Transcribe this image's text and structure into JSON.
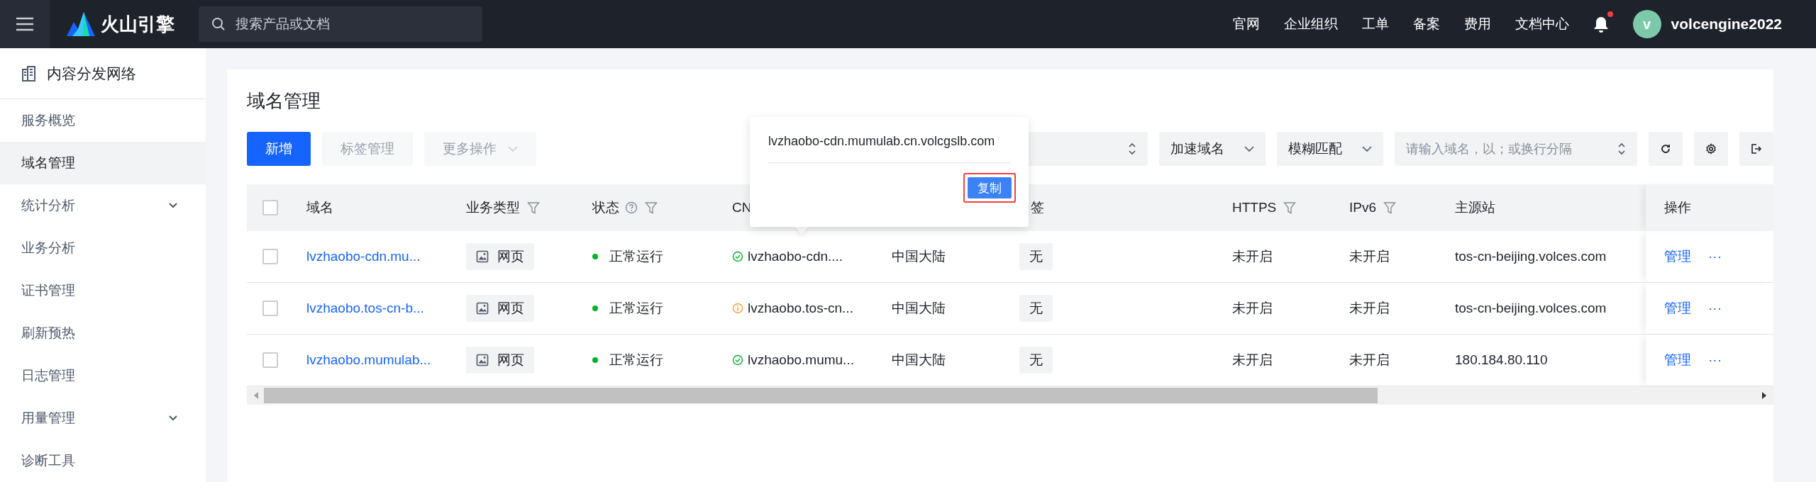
{
  "topbar": {
    "brand": "火山引擎",
    "search": {
      "placeholder": "搜索产品或文档"
    },
    "links": [
      "官网",
      "企业组织",
      "工单",
      "备案",
      "费用",
      "文档中心"
    ],
    "notification_dot": true,
    "user": {
      "avatar": "v",
      "name": "volcengine2022"
    }
  },
  "sidebar": {
    "title": "内容分发网络",
    "items": [
      {
        "label": "服务概览",
        "selected": false,
        "expandable": false
      },
      {
        "label": "域名管理",
        "selected": true,
        "expandable": false
      },
      {
        "label": "统计分析",
        "selected": false,
        "expandable": true
      },
      {
        "label": "业务分析",
        "selected": false,
        "expandable": false
      },
      {
        "label": "证书管理",
        "selected": false,
        "expandable": false
      },
      {
        "label": "刷新预热",
        "selected": false,
        "expandable": false
      },
      {
        "label": "日志管理",
        "selected": false,
        "expandable": false
      },
      {
        "label": "用量管理",
        "selected": false,
        "expandable": true
      },
      {
        "label": "诊断工具",
        "selected": false,
        "expandable": false
      }
    ]
  },
  "page": {
    "title": "域名管理",
    "buttons": [
      {
        "label": "新增",
        "kind": "primary",
        "disabled": false
      },
      {
        "label": "标签管理",
        "kind": "plain",
        "disabled": true
      },
      {
        "label": "更多操作",
        "kind": "menu",
        "disabled": true
      }
    ],
    "filters": [
      {
        "kind": "updown"
      },
      {
        "kind": "select",
        "value": "加速域名"
      },
      {
        "kind": "select",
        "value": "模糊匹配"
      },
      {
        "kind": "search",
        "placeholder": "请输入域名，以；或换行分隔"
      }
    ]
  },
  "table": {
    "header_checked": false,
    "columns": [
      {
        "label": "域名",
        "filter": false,
        "help": false
      },
      {
        "label": "业务类型",
        "filter": true,
        "help": false
      },
      {
        "label": "状态",
        "filter": true,
        "help": true
      },
      {
        "label": "CN",
        "filter": false,
        "help": false
      },
      {
        "label": "签",
        "filter": false,
        "help": false
      },
      {
        "label": "HTTPS",
        "filter": true,
        "help": false
      },
      {
        "label": "IPv6",
        "filter": true,
        "help": false
      },
      {
        "label": "主源站",
        "filter": false,
        "help": false
      },
      {
        "label": "操作",
        "filter": false,
        "help": false
      }
    ],
    "rows": [
      {
        "checked": false,
        "domain": "lvzhaobo-cdn.mu...",
        "type": "网页",
        "status": "正常运行",
        "color": "#00b42a",
        "cname": {
          "text": "lvzhaobo-cdn....",
          "kind": "ok"
        },
        "region": "中国大陆",
        "tag": "无",
        "https": "未开启",
        "ipv6": "未开启",
        "origin": "tos-cn-beijing.volces.com",
        "action": "管理",
        "more": "···"
      },
      {
        "checked": false,
        "domain": "lvzhaobo.tos-cn-b...",
        "type": "网页",
        "status": "正常运行",
        "color": "#00b42a",
        "cname": {
          "text": "lvzhaobo.tos-cn...",
          "kind": "warning"
        },
        "region": "中国大陆",
        "tag": "无",
        "https": "未开启",
        "ipv6": "未开启",
        "origin": "tos-cn-beijing.volces.com",
        "action": "管理",
        "more": "···"
      },
      {
        "checked": false,
        "domain": "lvzhaobo.mumulab...",
        "type": "网页",
        "status": "正常运行",
        "color": "#00b42a",
        "cname": {
          "text": "lvzhaobo.mumu...",
          "kind": "ok"
        },
        "region": "中国大陆",
        "tag": "无",
        "https": "未开启",
        "ipv6": "未开启",
        "origin": "180.184.80.110",
        "action": "管理",
        "more": "···"
      }
    ]
  },
  "popover": {
    "text": "lvzhaobo-cdn.mumulab.cn.volcgslb.com",
    "button": "复制",
    "highlighted": true
  }
}
